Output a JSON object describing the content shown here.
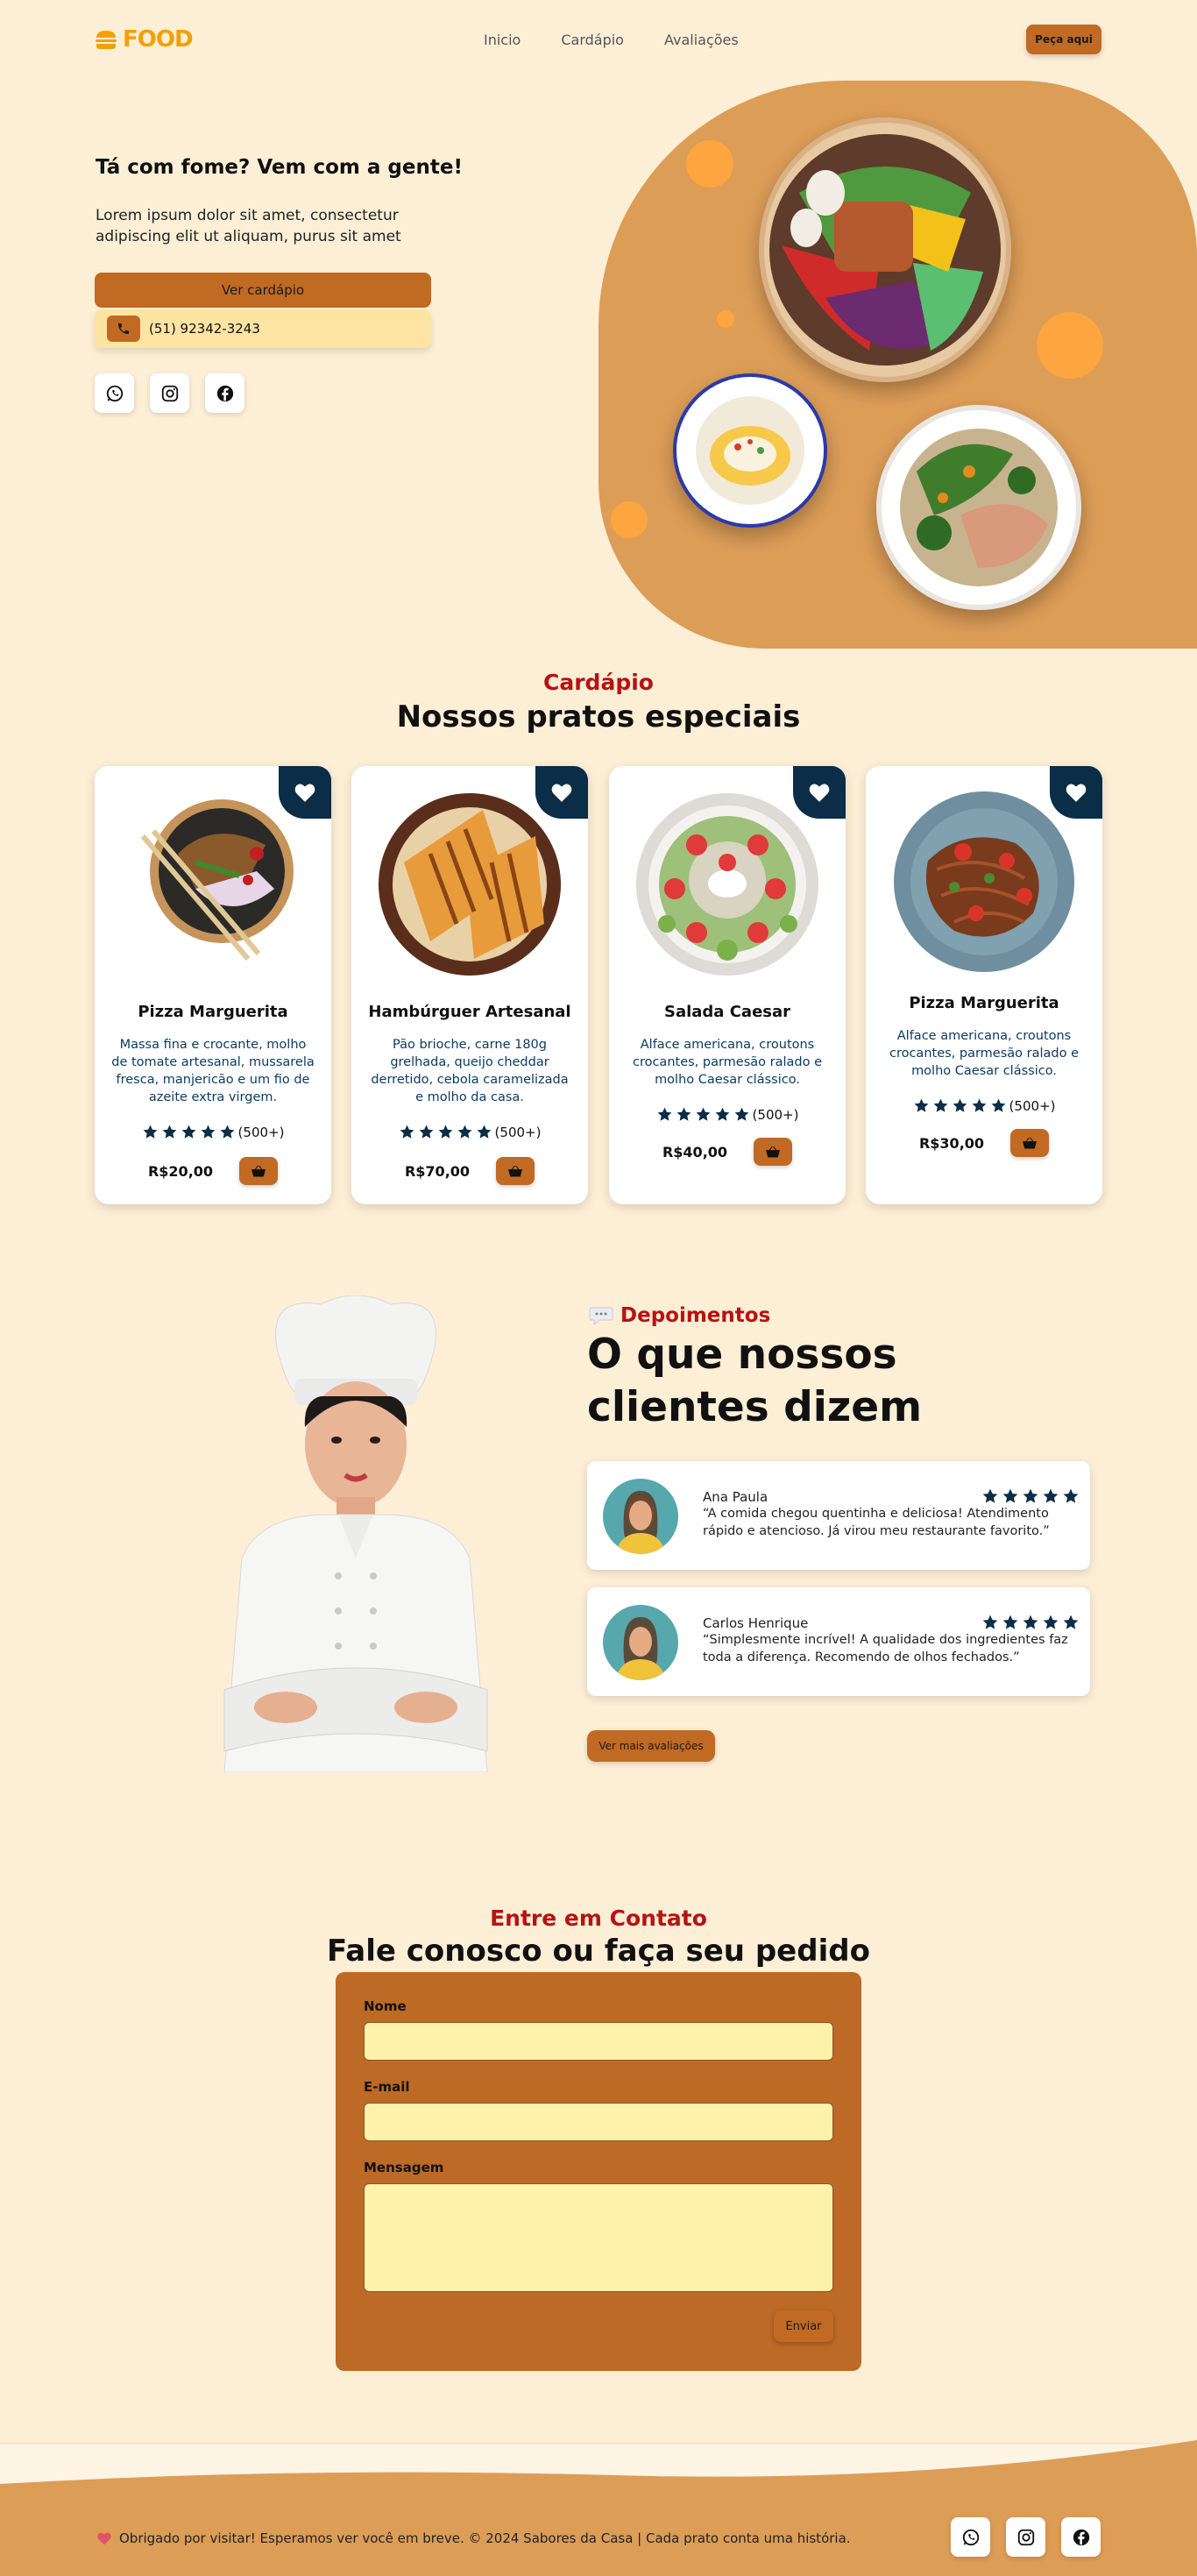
{
  "nav": {
    "logo": "FOOD",
    "links": [
      "Inicio",
      "Cardápio",
      "Avaliações"
    ],
    "order_button": "Peça aqui"
  },
  "hero": {
    "title": "Tá com fome? Vem com a gente!",
    "text": "Lorem ipsum dolor sit amet, consectetur adipiscing elit ut aliquam, purus sit amet",
    "menu_button": "Ver cardápio",
    "phone": "(51) 92342-3243",
    "socials": [
      "whatsapp-icon",
      "instagram-icon",
      "facebook-icon"
    ]
  },
  "menu": {
    "label": "Cardápio",
    "title": "Nossos pratos especiais",
    "cards": [
      {
        "name": "Pizza Marguerita",
        "desc": "Massa fina e crocante, molho de tomate artesanal, mussarela fresca, manjericão e um fio de azeite extra virgem.",
        "reviews": "(500+)",
        "rating": 5,
        "price": "R$20,00"
      },
      {
        "name": "Hambúrguer Artesanal",
        "desc": "Pão brioche, carne 180g grelhada, queijo cheddar derretido, cebola caramelizada e molho da casa.",
        "reviews": "(500+)",
        "rating": 5,
        "price": "R$70,00"
      },
      {
        "name": "Salada Caesar",
        "desc": "Alface americana, croutons crocantes, parmesão ralado e molho Caesar clássico.",
        "reviews": "(500+)",
        "rating": 5,
        "price": "R$40,00"
      },
      {
        "name": "Pizza Marguerita",
        "desc": "Alface americana, croutons crocantes, parmesão ralado e molho Caesar clássico.",
        "reviews": "(500+)",
        "rating": 5,
        "price": "R$30,00"
      }
    ]
  },
  "testimonials": {
    "label": "Depoimentos",
    "title": "O que nossos clientes dizem",
    "items": [
      {
        "name": "Ana Paula",
        "text": "“A comida chegou quentinha e deliciosa! Atendimento rápido e atencioso. Já virou meu restaurante favorito.”",
        "rating": 5
      },
      {
        "name": "Carlos Henrique",
        "text": "“Simplesmente incrível! A qualidade dos ingredientes faz toda a diferença. Recomendo de olhos fechados.”",
        "rating": 5
      }
    ],
    "more_button": "Ver mais avaliações"
  },
  "contact": {
    "label": "Entre em Contato",
    "title": "Fale conosco ou faça seu pedido",
    "fields": {
      "name": "Nome",
      "email": "E-mail",
      "message": "Mensagem"
    },
    "send_button": "Enviar"
  },
  "footer": {
    "text": "Obrigado por visitar! Esperamos ver você em breve. © 2024 Sabores da Casa | Cada prato conta uma história."
  },
  "colors": {
    "background": "#fdefd6",
    "accent": "#c06a24",
    "hero_shape": "#dc9d57",
    "heading_red": "#b81212",
    "navy": "#0b2d47"
  }
}
